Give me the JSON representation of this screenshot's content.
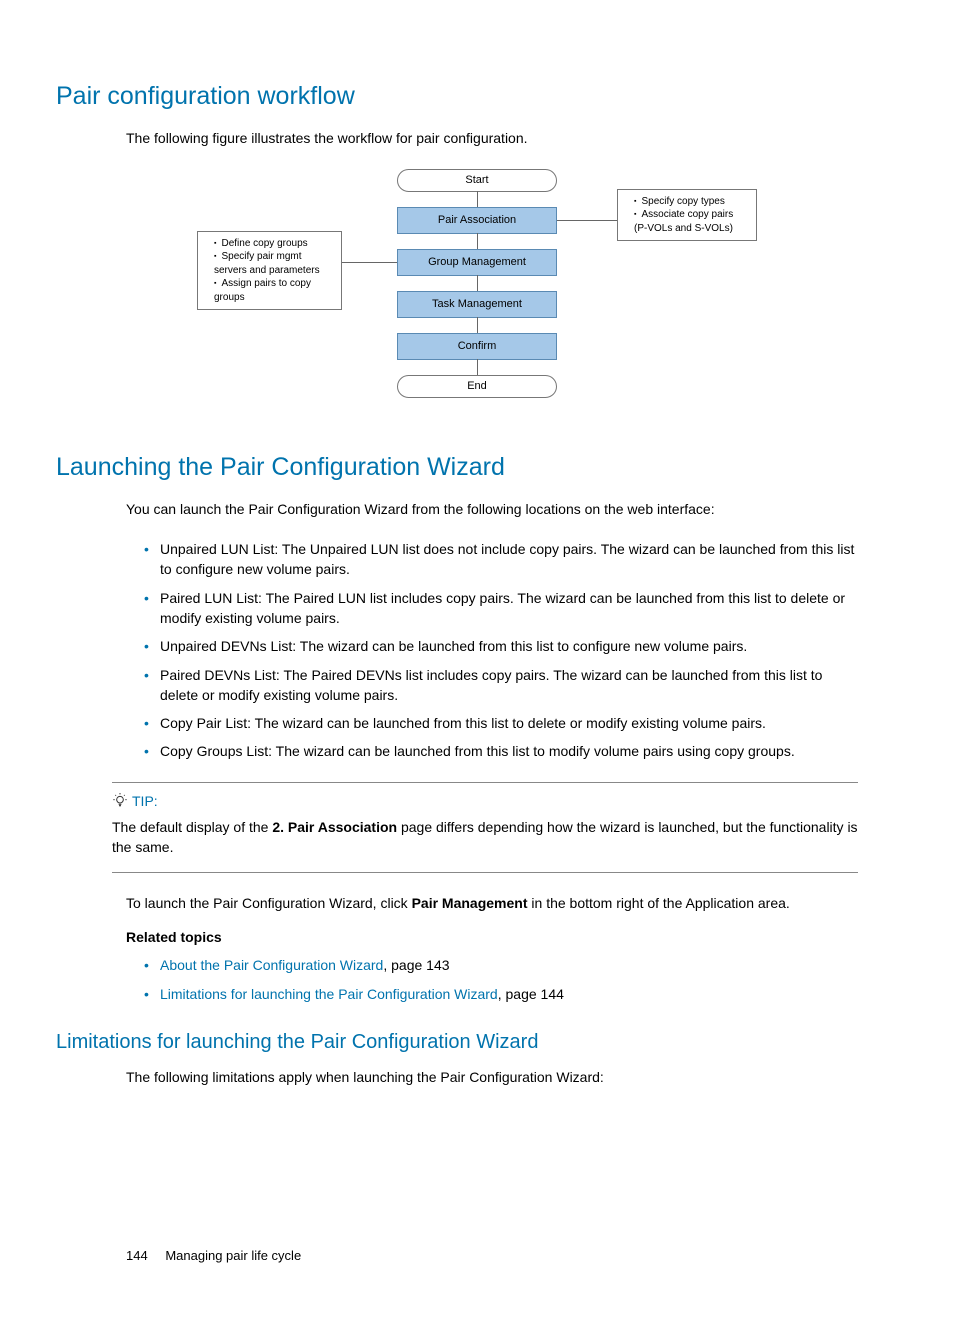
{
  "section1": {
    "heading": "Pair configuration workflow",
    "intro": "The following figure illustrates the workflow for pair configuration."
  },
  "flowchart": {
    "start": "Start",
    "step1": "Pair Association",
    "step2": "Group Management",
    "step3": "Task Management",
    "step4": "Confirm",
    "end": "End",
    "left": {
      "items": [
        "Define copy groups",
        "Specify pair mgmt servers and parameters",
        "Assign pairs to copy groups"
      ]
    },
    "right": {
      "items": [
        "Specify copy types",
        "Associate copy pairs (P-VOLs and S-VOLs)"
      ]
    }
  },
  "section2": {
    "heading": "Launching the Pair Configuration Wizard",
    "intro": "You can launch the Pair Configuration Wizard from the following locations on the web interface:",
    "items": [
      "Unpaired LUN List: The Unpaired LUN list does not include copy pairs. The wizard can be launched from this list to configure new volume pairs.",
      "Paired LUN List:  The Paired LUN list includes copy pairs. The wizard can be launched from this list to delete or modify existing volume pairs.",
      "Unpaired DEVNs List: The wizard can be launched from this list to configure new volume pairs.",
      "Paired DEVNs List: The Paired DEVNs list includes copy pairs. The wizard can be launched from this list to delete or modify existing volume pairs.",
      "Copy Pair List: The wizard can be launched from this list to delete or modify existing volume pairs.",
      "Copy Groups List: The wizard can be launched from this list to modify volume pairs using copy groups."
    ],
    "tip_label": "TIP:",
    "tip_pre": "The default display of the ",
    "tip_bold": "2. Pair Association",
    "tip_post": " page differs depending how the wizard is launched, but the functionality is the same.",
    "launch_pre": "To launch the Pair Configuration Wizard, click ",
    "launch_bold": "Pair Management",
    "launch_post": " in the bottom right of the Application area.",
    "related_head": "Related topics",
    "related": [
      {
        "link": "About the Pair Configuration Wizard",
        "suffix": ", page 143"
      },
      {
        "link": "Limitations for launching the Pair Configuration Wizard",
        "suffix": ", page 144"
      }
    ]
  },
  "section3": {
    "heading": "Limitations for launching the Pair Configuration Wizard",
    "intro": "The following limitations apply when launching the Pair Configuration Wizard:"
  },
  "footer": {
    "page": "144",
    "title": "Managing pair life cycle"
  }
}
